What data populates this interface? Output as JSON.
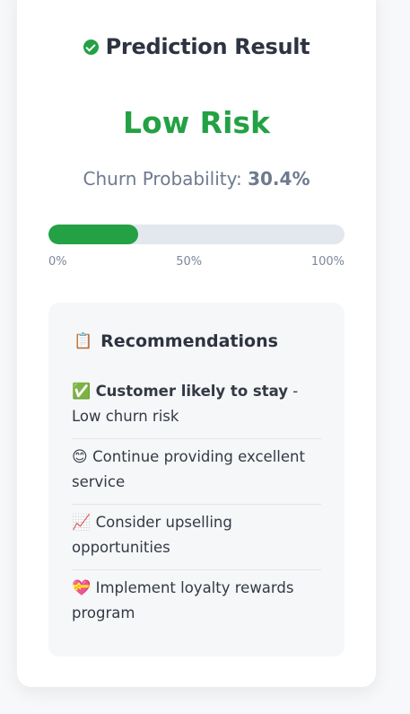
{
  "header": {
    "title": "Prediction Result",
    "icon": "check-circle-icon"
  },
  "result": {
    "risk_label": "Low Risk",
    "risk_color": "#23a144",
    "probability_label": "Churn Probability:",
    "probability_value": "30.4%",
    "probability_fraction": 0.304
  },
  "progress": {
    "ticks": [
      "0%",
      "50%",
      "100%"
    ]
  },
  "recommendations": {
    "icon": "📋",
    "title": "Recommendations",
    "items": [
      {
        "icon": "✅",
        "bold": "Customer likely to stay",
        "text": " - Low churn risk"
      },
      {
        "icon": "😊",
        "bold": "",
        "text": "Continue providing excellent service"
      },
      {
        "icon": "📈",
        "bold": "",
        "text": "Consider upselling opportunities"
      },
      {
        "icon": "💝",
        "bold": "",
        "text": "Implement loyalty rewards program"
      }
    ]
  }
}
